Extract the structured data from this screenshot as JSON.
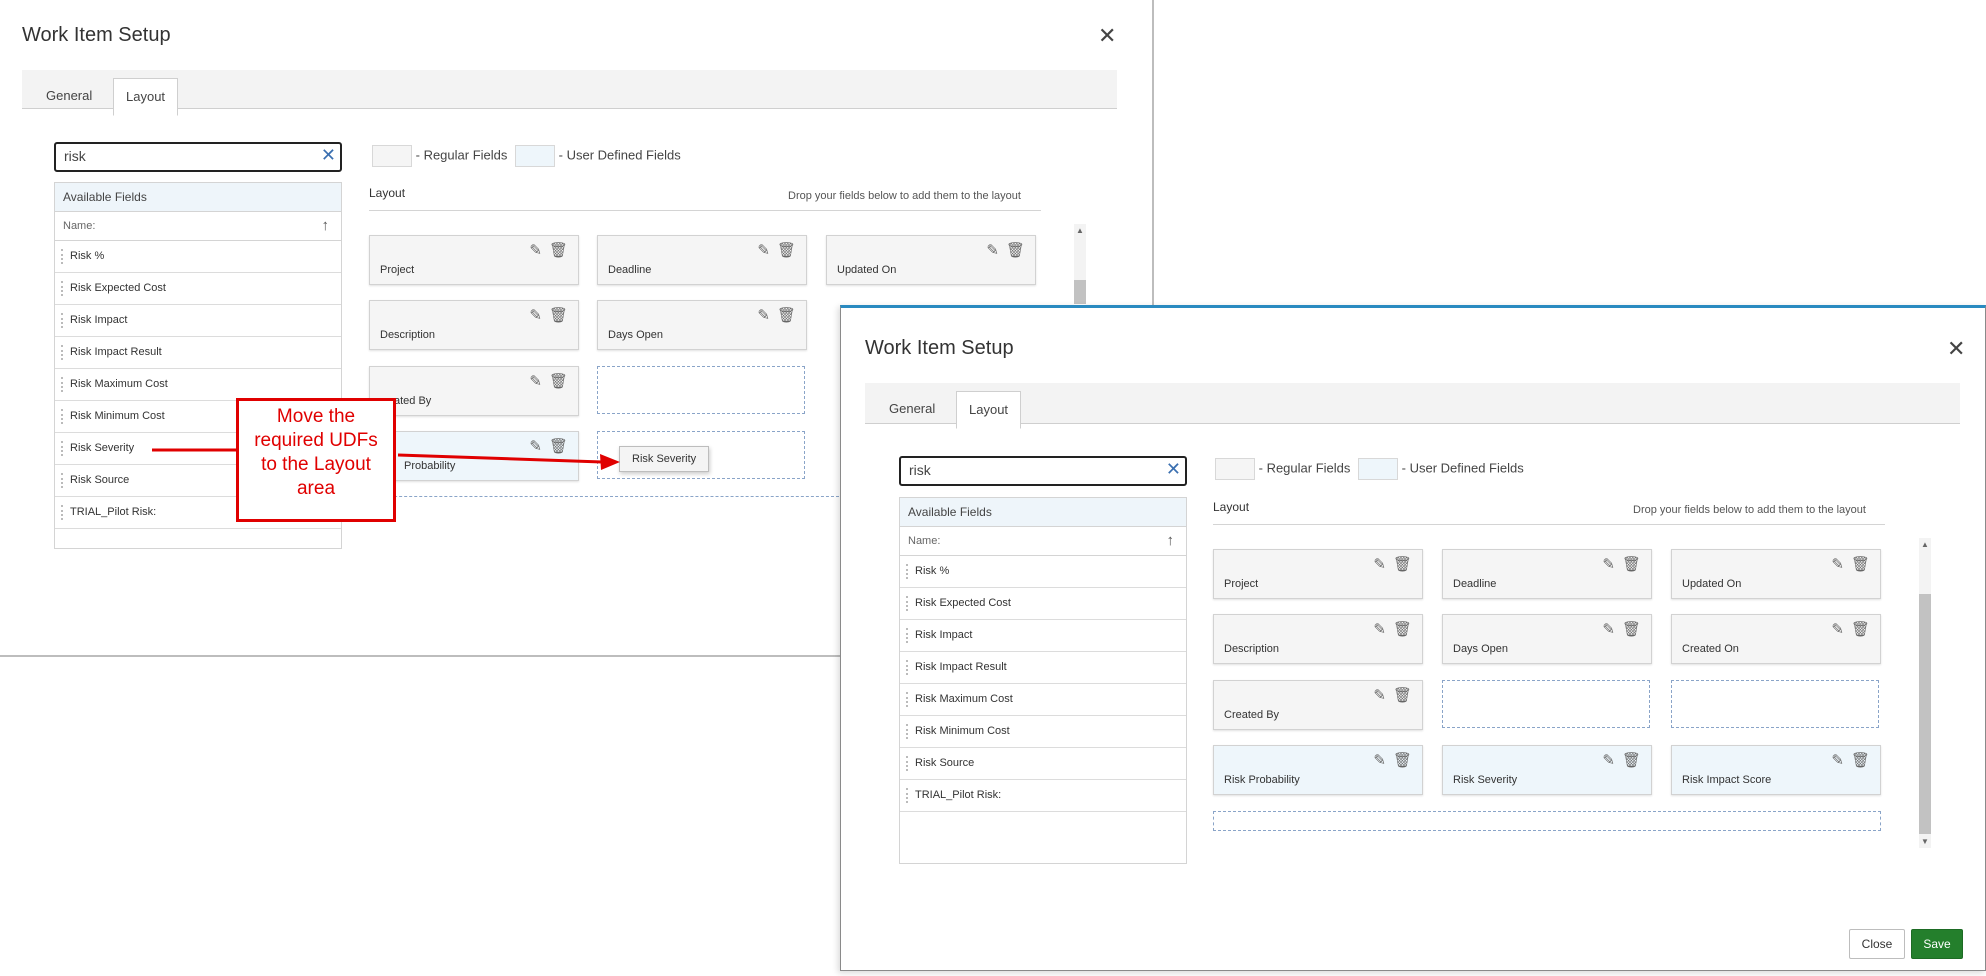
{
  "back_dialog": {
    "title": "Work Item Setup",
    "close_glyph": "✕",
    "tabs": [
      {
        "label": "General"
      },
      {
        "label": "Layout"
      }
    ],
    "search": {
      "value": "risk"
    },
    "legend": {
      "regular": "- Regular Fields",
      "udf": "- User Defined Fields"
    },
    "available": {
      "header": "Available Fields",
      "name_label": "Name:",
      "items": [
        "Risk %",
        "Risk Expected Cost",
        "Risk Impact",
        "Risk Impact Result",
        "Risk Maximum Cost",
        "Risk Minimum Cost",
        "Risk Severity",
        "Risk Source",
        "TRIAL_Pilot Risk:"
      ]
    },
    "layout": {
      "heading": "Layout",
      "hint": "Drop your fields below to add them to the layout",
      "cards": [
        "Project",
        "Deadline",
        "Updated On",
        "Description",
        "Days Open",
        "ated By",
        "Probability"
      ]
    },
    "dragged_field": "Risk Severity"
  },
  "callout": {
    "lines": [
      "Move the",
      "required UDFs",
      "to the Layout",
      "area"
    ]
  },
  "front_dialog": {
    "title": "Work Item Setup",
    "close_glyph": "✕",
    "tabs": [
      {
        "label": "General"
      },
      {
        "label": "Layout"
      }
    ],
    "search": {
      "value": "risk"
    },
    "legend": {
      "regular": "- Regular Fields",
      "udf": "- User Defined Fields"
    },
    "available": {
      "header": "Available Fields",
      "name_label": "Name:",
      "items": [
        "Risk %",
        "Risk Expected Cost",
        "Risk Impact",
        "Risk Impact Result",
        "Risk Maximum Cost",
        "Risk Minimum Cost",
        "Risk Source",
        "TRIAL_Pilot Risk:"
      ]
    },
    "layout": {
      "heading": "Layout",
      "hint": "Drop your fields below to add them to the layout",
      "cards": [
        "Project",
        "Deadline",
        "Updated On",
        "Description",
        "Days Open",
        "Created On",
        "Created By",
        "Risk Probability",
        "Risk Severity",
        "Risk Impact Score"
      ]
    },
    "buttons": {
      "close": "Close",
      "save": "Save"
    }
  },
  "icons": {
    "edit": "pencil-icon",
    "trash": "trash-icon",
    "sort": "sort-arrow-icon"
  },
  "colors": {
    "udf_fill": "#eef6fb",
    "regular_fill": "#f5f5f5",
    "save_green": "#247f2c",
    "callout_red": "#e00000"
  }
}
